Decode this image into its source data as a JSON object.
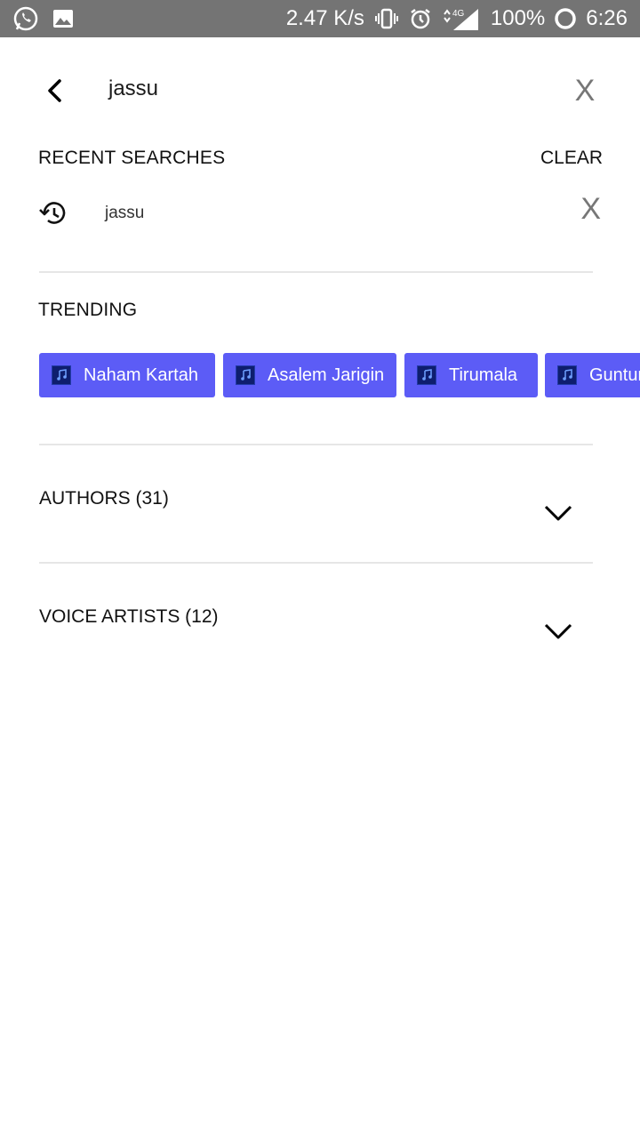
{
  "status_bar": {
    "left_icons": [
      "whatsapp-icon",
      "image-icon"
    ],
    "net_speed": "2.47 K/s",
    "network": "4G",
    "battery": "100%",
    "time": "6:26"
  },
  "search": {
    "query": "jassu",
    "back_icon": "chevron-left-icon",
    "clear_icon_label": "X"
  },
  "recent": {
    "title": "RECENT SEARCHES",
    "clear_label": "CLEAR",
    "items": [
      {
        "text": "jassu",
        "remove_label": "X"
      }
    ]
  },
  "trending": {
    "title": "TRENDING",
    "chips": [
      {
        "label": "Naham Kartah"
      },
      {
        "label": "Asalem Jarigin"
      },
      {
        "label": "Tirumala"
      },
      {
        "label": "Guntur"
      }
    ]
  },
  "sections": [
    {
      "label": "AUTHORS (31)"
    },
    {
      "label": "VOICE ARTISTS (12)"
    }
  ],
  "colors": {
    "status_bar": "#747474",
    "chip": "#5c5cf6",
    "divider": "#e6e6e6"
  }
}
